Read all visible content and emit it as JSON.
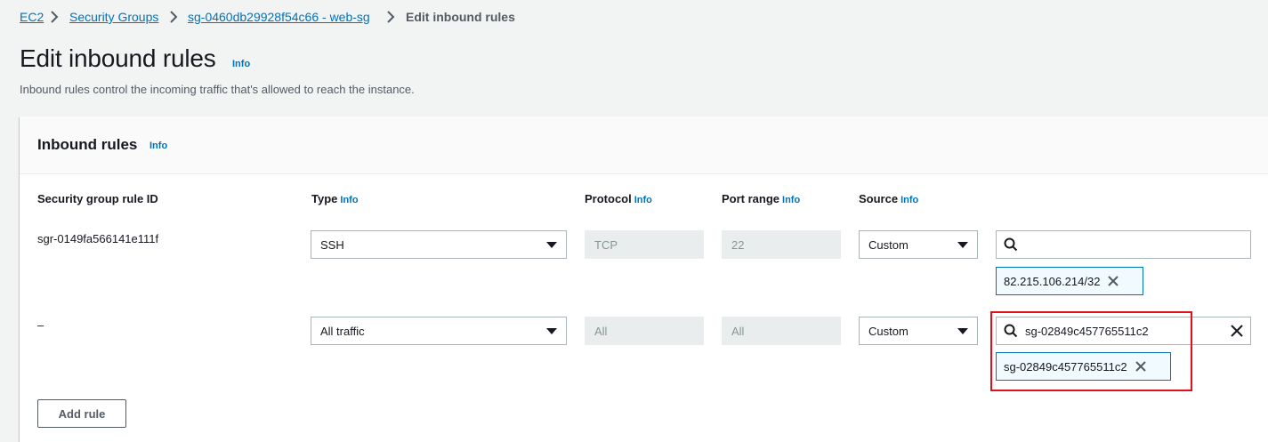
{
  "breadcrumb": {
    "items": [
      "EC2",
      "Security Groups",
      "sg-0460db29928f54c66 - web-sg"
    ],
    "current": "Edit inbound rules"
  },
  "header": {
    "title": "Edit inbound rules",
    "info": "Info",
    "description": "Inbound rules control the incoming traffic that's allowed to reach the instance."
  },
  "panel": {
    "title": "Inbound rules",
    "info": "Info",
    "columns": {
      "rule_id": "Security group rule ID",
      "type": "Type",
      "protocol": "Protocol",
      "port_range": "Port range",
      "source": "Source",
      "info": "Info"
    },
    "rules": [
      {
        "rule_id": "sgr-0149fa566141e111f",
        "type": "SSH",
        "protocol": "TCP",
        "port_range": "22",
        "source_type": "Custom",
        "search_value": "",
        "token": "82.215.106.214/32"
      },
      {
        "rule_id": "–",
        "type": "All traffic",
        "protocol": "All",
        "port_range": "All",
        "source_type": "Custom",
        "search_value": "sg-02849c457765511c2",
        "token": "sg-02849c457765511c2"
      }
    ],
    "add_rule_label": "Add rule"
  },
  "colors": {
    "link": "#0073bb",
    "highlight": "#e0101a",
    "background": "#f2f3f3"
  },
  "icons": [
    "chevron-right-icon",
    "caret-down-icon",
    "search-icon",
    "close-icon"
  ]
}
